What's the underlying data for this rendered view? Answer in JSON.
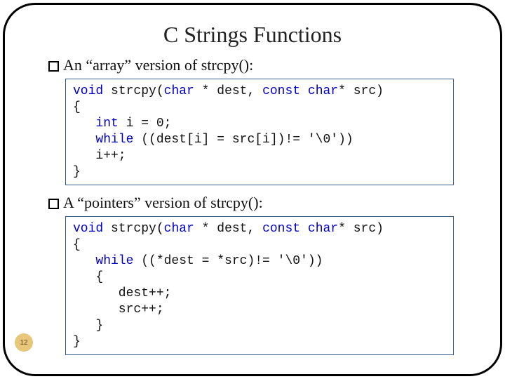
{
  "title": "C Strings Functions",
  "bullets": {
    "array": "An “array” version of strcpy():",
    "pointers": "A “pointers” version of strcpy():"
  },
  "code1": {
    "l1a": "void",
    "l1b": " strcpy(",
    "l1c": "char",
    "l1d": " * dest, ",
    "l1e": "const char",
    "l1f": "* src)",
    "l2": "{",
    "l3a": "   ",
    "l3b": "int",
    "l3c": " i = 0;",
    "l4a": "   ",
    "l4b": "while",
    "l4c": " ((dest[i] = src[i])!= '\\0'))",
    "l5": "   i++;",
    "l6": "}"
  },
  "code2": {
    "l1a": "void",
    "l1b": " strcpy(",
    "l1c": "char",
    "l1d": " * dest, ",
    "l1e": "const char",
    "l1f": "* src)",
    "l2": "{",
    "l3a": "   ",
    "l3b": "while",
    "l3c": " ((*dest = *src)!= '\\0'))",
    "l4": "   {",
    "l5": "      dest++;",
    "l6": "      src++;",
    "l7": "   }",
    "l8": "}"
  },
  "page_number": "12"
}
